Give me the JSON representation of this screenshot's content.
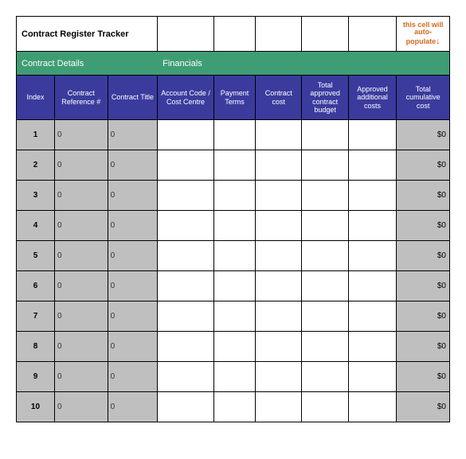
{
  "title": "Contract Register Tracker",
  "auto_populate_note": "this cell will auto-populate",
  "sections": {
    "details": "Contract Details",
    "financials": "Financials"
  },
  "columns": [
    "Index",
    "Contract Reference #",
    "Contract Title",
    "Account Code / Cost Centre",
    "Payment Terms",
    "Contract cost",
    "Total approved contract budget",
    "Approved additional costs",
    "Total cumulative cost"
  ],
  "rows": [
    {
      "index": "1",
      "ref": "0",
      "title": "0",
      "account": "",
      "terms": "",
      "cost": "",
      "budget": "",
      "additional": "",
      "cumulative": "$0"
    },
    {
      "index": "2",
      "ref": "0",
      "title": "0",
      "account": "",
      "terms": "",
      "cost": "",
      "budget": "",
      "additional": "",
      "cumulative": "$0"
    },
    {
      "index": "3",
      "ref": "0",
      "title": "0",
      "account": "",
      "terms": "",
      "cost": "",
      "budget": "",
      "additional": "",
      "cumulative": "$0"
    },
    {
      "index": "4",
      "ref": "0",
      "title": "0",
      "account": "",
      "terms": "",
      "cost": "",
      "budget": "",
      "additional": "",
      "cumulative": "$0"
    },
    {
      "index": "5",
      "ref": "0",
      "title": "0",
      "account": "",
      "terms": "",
      "cost": "",
      "budget": "",
      "additional": "",
      "cumulative": "$0"
    },
    {
      "index": "6",
      "ref": "0",
      "title": "0",
      "account": "",
      "terms": "",
      "cost": "",
      "budget": "",
      "additional": "",
      "cumulative": "$0"
    },
    {
      "index": "7",
      "ref": "0",
      "title": "0",
      "account": "",
      "terms": "",
      "cost": "",
      "budget": "",
      "additional": "",
      "cumulative": "$0"
    },
    {
      "index": "8",
      "ref": "0",
      "title": "0",
      "account": "",
      "terms": "",
      "cost": "",
      "budget": "",
      "additional": "",
      "cumulative": "$0"
    },
    {
      "index": "9",
      "ref": "0",
      "title": "0",
      "account": "",
      "terms": "",
      "cost": "",
      "budget": "",
      "additional": "",
      "cumulative": "$0"
    },
    {
      "index": "10",
      "ref": "0",
      "title": "0",
      "account": "",
      "terms": "",
      "cost": "",
      "budget": "",
      "additional": "",
      "cumulative": "$0"
    }
  ]
}
